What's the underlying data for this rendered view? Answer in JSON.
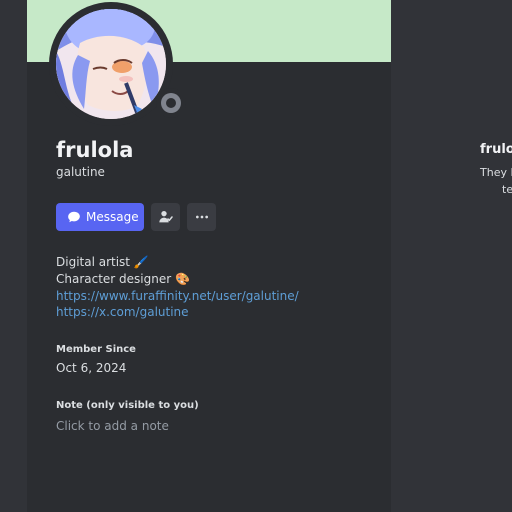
{
  "profile": {
    "display_name": "frulola",
    "username": "galutine",
    "banner_color": "#c6e9c8",
    "status_color": "#80848e",
    "status_icon": "offline-status-icon"
  },
  "actions": {
    "message_label": "Message",
    "message_icon": "chat-bubble-icon",
    "friend_icon": "add-friend-icon",
    "more_icon": "more-icon"
  },
  "bio": {
    "line1": "Digital artist 🖌️",
    "line2": "Character designer 🎨",
    "link1": "https://www.furaffinity.net/user/galutine/",
    "link2": "https://x.com/galutine"
  },
  "member_since": {
    "label": "Member Since",
    "value": "Oct 6, 2024"
  },
  "note": {
    "label": "Note (only visible to you)",
    "placeholder": "Click to add a note"
  },
  "right_panel": {
    "name": "frulol",
    "text1": "They l",
    "text2": "te"
  }
}
